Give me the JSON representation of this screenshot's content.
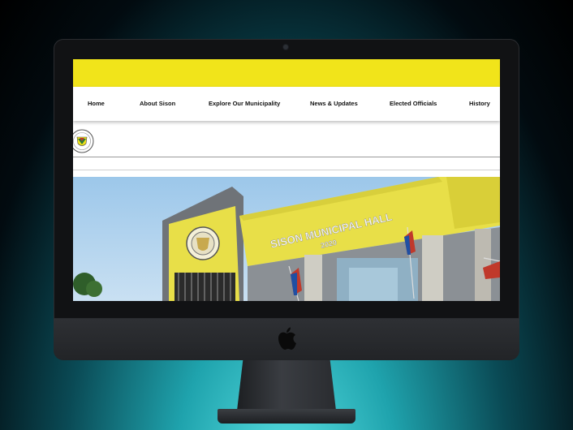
{
  "nav": {
    "items": [
      {
        "label": "Home"
      },
      {
        "label": "About Sison"
      },
      {
        "label": "Explore Our Municipality"
      },
      {
        "label": "News & Updates"
      },
      {
        "label": "Elected Officials"
      },
      {
        "label": "History"
      }
    ]
  },
  "hero": {
    "building_sign": "SISON MUNICIPAL HALL",
    "building_year": "2020"
  },
  "colors": {
    "topbar": "#f1e41a",
    "building_yellow": "#e8df48",
    "background_teal": "#1fa3ad"
  },
  "icons": [
    "municipal-seal-icon",
    "apple-logo-icon"
  ]
}
